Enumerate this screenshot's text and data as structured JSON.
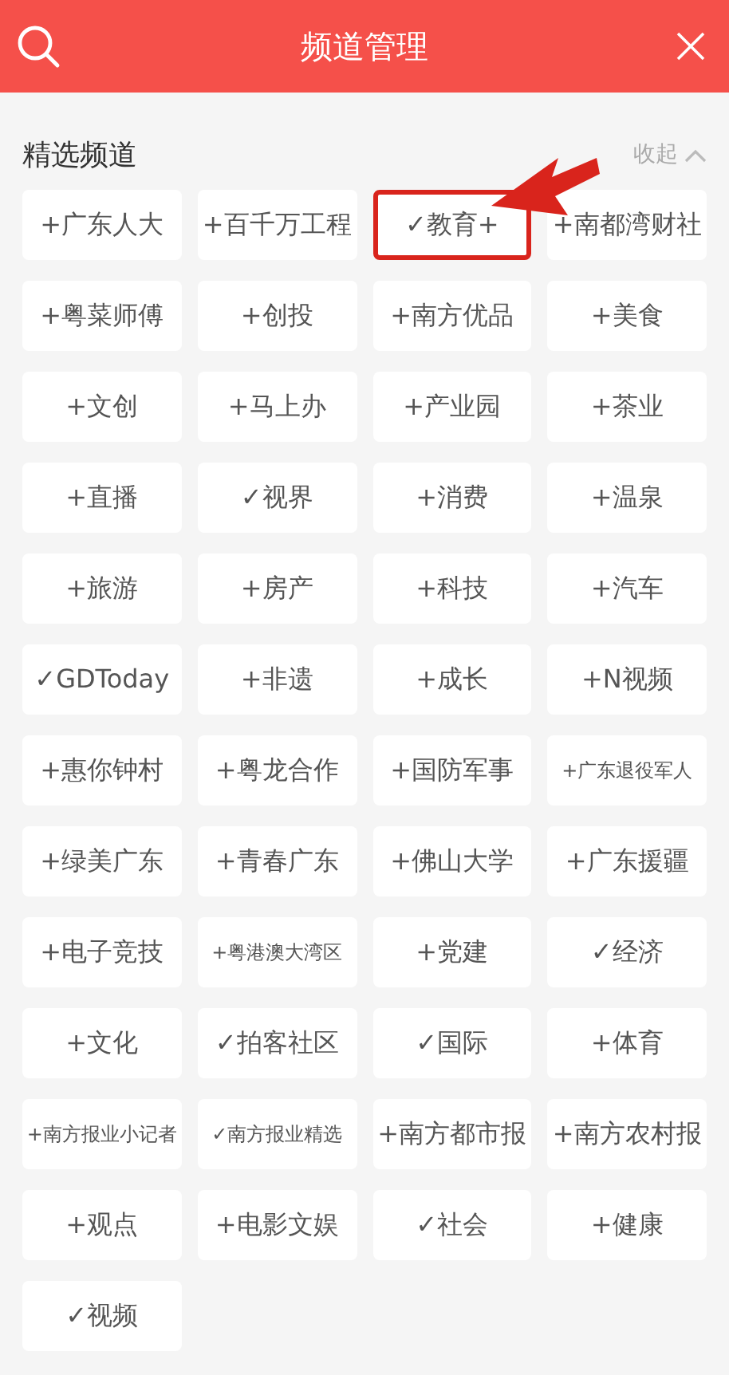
{
  "header": {
    "title": "频道管理"
  },
  "section": {
    "title": "精选频道",
    "toggle": "收起"
  },
  "channels": [
    {
      "label": "+广东人大",
      "highlighted": false
    },
    {
      "label": "+百千万工程",
      "highlighted": false
    },
    {
      "label": "✓教育+",
      "highlighted": true
    },
    {
      "label": "+南都湾财社",
      "highlighted": false
    },
    {
      "label": "+粤菜师傅",
      "highlighted": false
    },
    {
      "label": "+创投",
      "highlighted": false
    },
    {
      "label": "+南方优品",
      "highlighted": false
    },
    {
      "label": "+美食",
      "highlighted": false
    },
    {
      "label": "+文创",
      "highlighted": false
    },
    {
      "label": "+马上办",
      "highlighted": false
    },
    {
      "label": "+产业园",
      "highlighted": false
    },
    {
      "label": "+茶业",
      "highlighted": false
    },
    {
      "label": "+直播",
      "highlighted": false
    },
    {
      "label": "✓视界",
      "highlighted": false
    },
    {
      "label": "+消费",
      "highlighted": false
    },
    {
      "label": "+温泉",
      "highlighted": false
    },
    {
      "label": "+旅游",
      "highlighted": false
    },
    {
      "label": "+房产",
      "highlighted": false
    },
    {
      "label": "+科技",
      "highlighted": false
    },
    {
      "label": "+汽车",
      "highlighted": false
    },
    {
      "label": "✓GDToday",
      "highlighted": false
    },
    {
      "label": "+非遗",
      "highlighted": false
    },
    {
      "label": "+成长",
      "highlighted": false
    },
    {
      "label": "+N视频",
      "highlighted": false
    },
    {
      "label": "+惠你钟村",
      "highlighted": false
    },
    {
      "label": "+粤龙合作",
      "highlighted": false
    },
    {
      "label": "+国防军事",
      "highlighted": false
    },
    {
      "label": "+广东退役军人",
      "highlighted": false
    },
    {
      "label": "+绿美广东",
      "highlighted": false
    },
    {
      "label": "+青春广东",
      "highlighted": false
    },
    {
      "label": "+佛山大学",
      "highlighted": false
    },
    {
      "label": "+广东援疆",
      "highlighted": false
    },
    {
      "label": "+电子竞技",
      "highlighted": false
    },
    {
      "label": "+粤港澳大湾区",
      "highlighted": false
    },
    {
      "label": "+党建",
      "highlighted": false
    },
    {
      "label": "✓经济",
      "highlighted": false
    },
    {
      "label": "+文化",
      "highlighted": false
    },
    {
      "label": "✓拍客社区",
      "highlighted": false
    },
    {
      "label": "✓国际",
      "highlighted": false
    },
    {
      "label": "+体育",
      "highlighted": false
    },
    {
      "label": "+南方报业小记者",
      "highlighted": false
    },
    {
      "label": "✓南方报业精选",
      "highlighted": false
    },
    {
      "label": "+南方都市报",
      "highlighted": false
    },
    {
      "label": "+南方农村报",
      "highlighted": false
    },
    {
      "label": "+观点",
      "highlighted": false
    },
    {
      "label": "+电影文娱",
      "highlighted": false
    },
    {
      "label": "✓社会",
      "highlighted": false
    },
    {
      "label": "+健康",
      "highlighted": false
    },
    {
      "label": "✓视频",
      "highlighted": false
    }
  ]
}
